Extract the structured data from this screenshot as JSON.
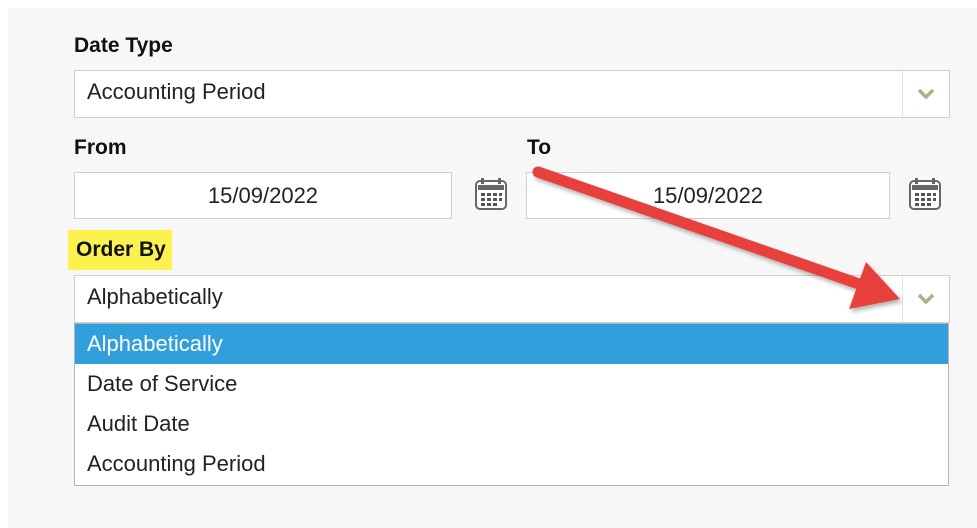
{
  "date_type": {
    "label": "Date Type",
    "value": "Accounting Period"
  },
  "from": {
    "label": "From",
    "value": "15/09/2022"
  },
  "to": {
    "label": "To",
    "value": "15/09/2022"
  },
  "order_by": {
    "label": "Order By",
    "value": "Alphabetically",
    "options": [
      "Alphabetically",
      "Date of Service",
      "Audit Date",
      "Accounting Period"
    ],
    "selected_index": 0
  },
  "colors": {
    "highlight": "#fbf24f",
    "selected_option": "#319fdc",
    "annotation_arrow": "#e8413e"
  },
  "icons": [
    "chevron-down-icon",
    "calendar-icon",
    "annotation-arrow"
  ]
}
